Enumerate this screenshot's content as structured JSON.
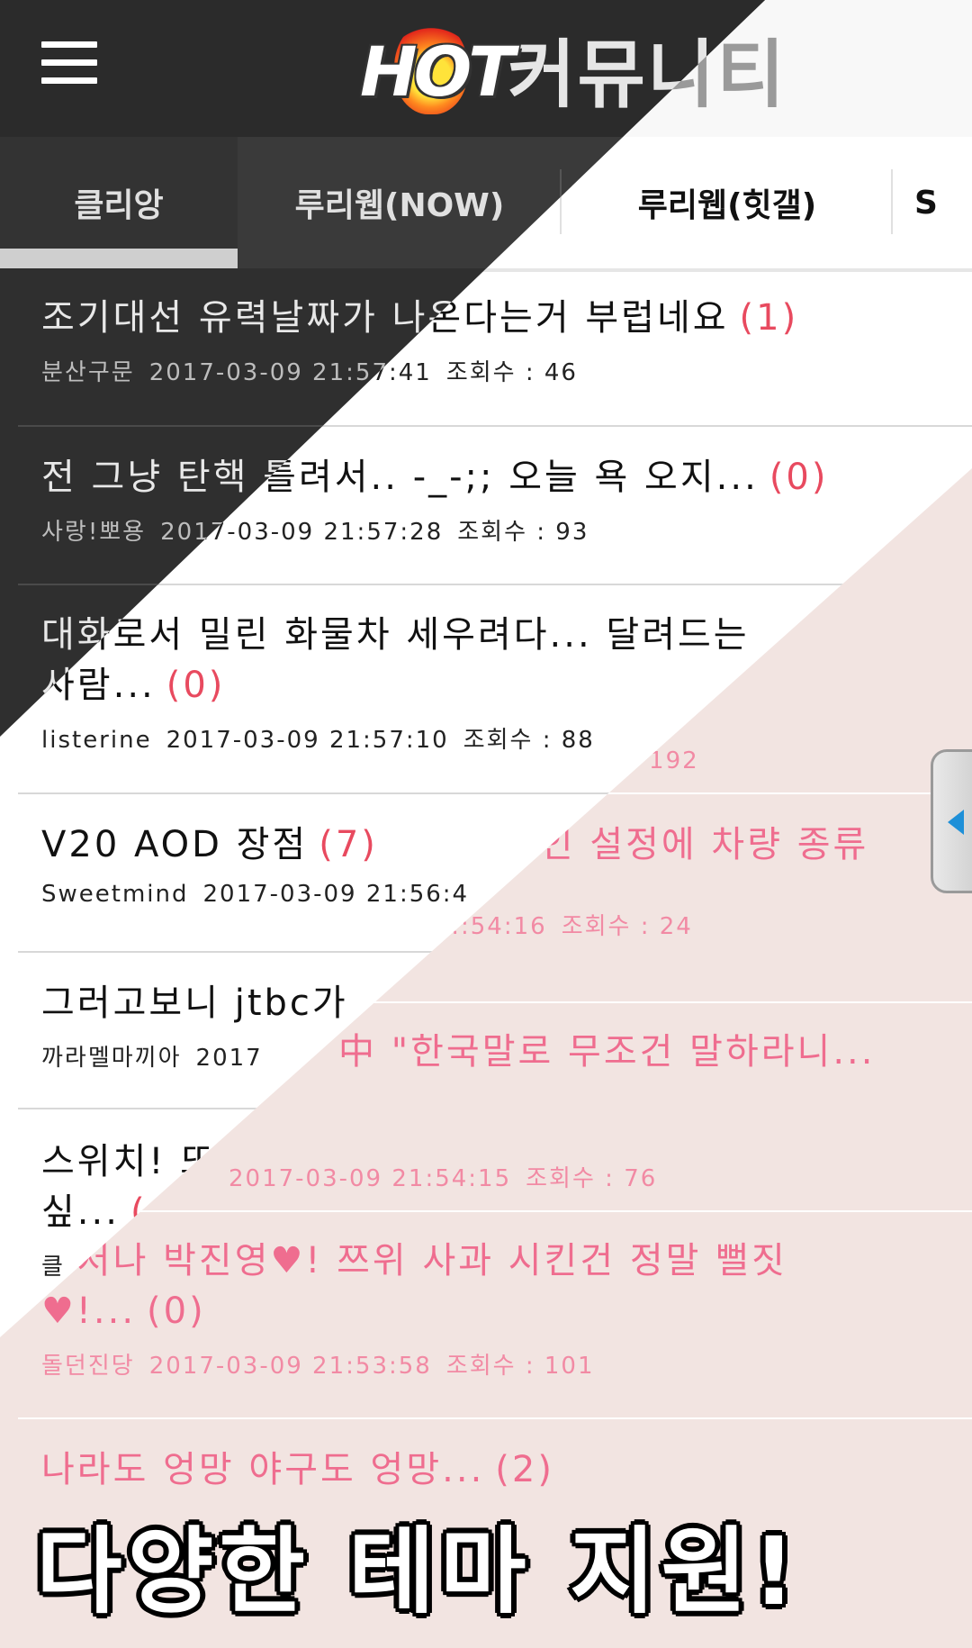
{
  "app": {
    "logo_text": "HOT",
    "title": "커뮤니티"
  },
  "tabs": [
    "클리앙",
    "루리웹(NOW)",
    "루리웹(힛갤)",
    "S"
  ],
  "pink_posts": [
    {
      "title": "",
      "comments": "",
      "author": "",
      "date": "",
      "views": ": 192"
    },
    {
      "title": "개인 설정에 차량 종류",
      "comments": "",
      "author": "",
      "date": "…:54:16",
      "views": "조회수 : 24"
    },
    {
      "title": "中 \"한국말로 무조건 말하라니...",
      "comments": "",
      "author": "",
      "date": "",
      "views": ""
    },
    {
      "title": "",
      "comments": "",
      "author": "",
      "date": "2017-03-09 21:54:15",
      "views": "조회수 : 76"
    },
    {
      "title": "나저나 박진영♥! 쯔위 사과 시킨건 정말 뻘짓♥!...",
      "comments": "(0)",
      "author": "",
      "date": "",
      "views": ""
    },
    {
      "title": "",
      "comments": "",
      "author": "돌던진당",
      "date": "2017-03-09 21:53:58",
      "views": "조회수 : 101"
    },
    {
      "title": "나라도 엉망 야구도 엉망...",
      "comments": "(2)",
      "author": "",
      "date": "",
      "views": ""
    }
  ],
  "posts": [
    {
      "title": "조기대선 유력날짜가 나온다는거 부럽네요",
      "comments": "(1)",
      "author": "분산구문",
      "date": "2017-03-09 21:57:41",
      "views": "조회수 : 46"
    },
    {
      "title": "전 그냥 탄핵 틀려서.. -_-;; 오늘 욕 오지...",
      "comments": "(0)",
      "author": "사랑!뽀용",
      "date": "2017-03-09 21:57:28",
      "views": "조회수 : 93"
    },
    {
      "title": "대화로서 밀린 화물차 세우려다... 달려드는 사람...",
      "comments": "(0)",
      "author": "listerine",
      "date": "2017-03-09 21:57:10",
      "views": "조회수 : 88"
    },
    {
      "title": "V20 AOD 장점",
      "comments": "(7)",
      "author": "Sweetmind",
      "date": "2017-03-09 21:56:4",
      "views": ""
    },
    {
      "title": "그러고보니 jtbc가",
      "comments": "",
      "author": "까라멜마끼아",
      "date": "2017",
      "views": ""
    },
    {
      "title": "스위치! 또 사고 싶...",
      "comments": "(",
      "author": "클",
      "date": "",
      "views": ""
    }
  ],
  "banner": "다양한 테마 지원!",
  "icons": {
    "menu": "hamburger-icon",
    "drawer": "chevron-left-icon"
  },
  "colors": {
    "dark_bg": "#2f2f2f",
    "pink_bg": "#f2e4e1",
    "pink_text": "#ef6d8f",
    "comment_red": "#e84a5f",
    "drawer_arrow": "#1e90d8"
  }
}
